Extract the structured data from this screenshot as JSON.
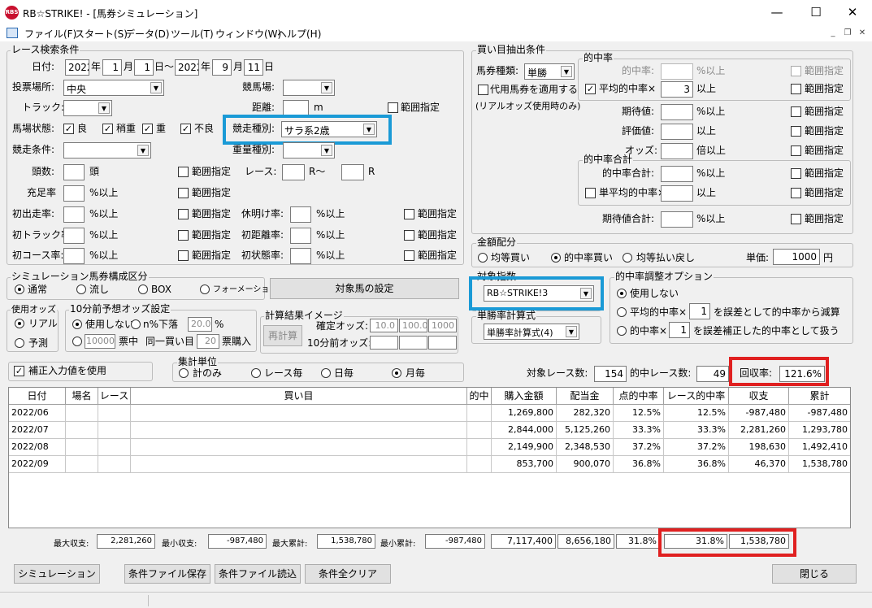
{
  "window": {
    "logo": "RBS",
    "title": "RB☆STRIKE! - [馬券シミュレーション]",
    "minimize": "—",
    "maximize": "☐",
    "close": "✕"
  },
  "menu": [
    "ファイル(F)",
    "スタート(S)",
    "データ(D)",
    "ツール(T)",
    "ウィンドウ(W)",
    "ヘルプ(H)"
  ],
  "mdi": {
    "min": "_",
    "restore": "❐",
    "close": "✕"
  },
  "race": {
    "group": "レース検索条件",
    "date_label": "日付:",
    "y1": "2022",
    "m1": "1",
    "d1": "1",
    "y2": "2022",
    "m2": "9",
    "d2": "11",
    "u_year": "年",
    "u_month": "月",
    "u_day_from": "日〜",
    "u_year2": "年",
    "u_month2": "月",
    "u_day2": "日",
    "venue_label": "投票場所:",
    "venue": "中央",
    "course_label": "競馬場:",
    "track_label": "トラック:",
    "distance_label": "距離:",
    "distance_unit": "m",
    "range": "範囲指定",
    "condition_label": "馬場状態:",
    "c1": "良",
    "c2": "稍重",
    "c3": "重",
    "c4": "不良",
    "race_type_label": "競走種別:",
    "race_type": "サラ系2歳",
    "cond_label": "競走条件:",
    "weight_label": "重量種別:",
    "heads_label": "頭数:",
    "heads_unit": "頭",
    "race_no_label": "レース:",
    "race_from": "R〜",
    "race_to": "R",
    "fill_label": "充足率",
    "pct_above": "%以上",
    "first_run": "初出走率:",
    "first_track": "初トラック率:",
    "first_course": "初コース率:",
    "rest": "休明け率:",
    "first_dist": "初距離率:",
    "first_state": "初状態率:"
  },
  "sim": {
    "group": "シミュレーション馬券構成区分",
    "o1": "通常",
    "o2": "流し",
    "o3": "BOX",
    "o4": "フォーメーション",
    "target_btn": "対象馬の設定"
  },
  "odds": {
    "group": "使用オッズ",
    "o1": "リアル",
    "o2": "予測"
  },
  "odds10": {
    "group": "10分前予想オッズ設定",
    "o1": "使用しない",
    "o2": "n%下落",
    "pct": "20.0",
    "pct_unit": "%",
    "votes": "10000",
    "votes_label": "票中",
    "same": "同一買い目",
    "buy": "20",
    "buy_label": "票購入"
  },
  "calc": {
    "group": "計算結果イメージ",
    "btn": "再計算",
    "fixed": "確定オッズ:",
    "v1": "10.0",
    "v2": "100.0",
    "v3": "1000",
    "pre": "10分前オッズ:"
  },
  "correct": "補正入力値を使用",
  "agg": {
    "group": "集計単位",
    "o1": "計のみ",
    "o2": "レース毎",
    "o3": "日毎",
    "o4": "月毎"
  },
  "buy": {
    "group": "買い目抽出条件",
    "type_label": "馬券種類:",
    "type": "単勝",
    "proxy": "代用馬券を適用する",
    "proxy_note": "(リアルオッズ使用時のみ)"
  },
  "hit": {
    "group": "的中率",
    "rate": "的中率:",
    "pct_above": "%以上",
    "avg": "平均的中率×",
    "avg_val": "3",
    "above": "以上",
    "range": "範囲指定",
    "exp": "期待値:",
    "eval": "評価値:",
    "odds": "オッズ:",
    "times_above": "倍以上"
  },
  "hitsum": {
    "group": "的中率合計",
    "sum": "的中率合計:",
    "pct_above": "%以上",
    "single": "単平均的中率×",
    "above": "以上",
    "exp_sum": "期待値合計:"
  },
  "money": {
    "group": "金額配分",
    "o1": "均等買い",
    "o2": "的中率買い",
    "o3": "均等払い戻し",
    "unit_label": "単価:",
    "unit": "1000",
    "yen": "円"
  },
  "index": {
    "group": "対象指数",
    "value": "RB☆STRIKE!3"
  },
  "formula": {
    "group": "単勝率計算式",
    "value": "単勝率計算式(4)"
  },
  "adjust": {
    "group": "的中率調整オプション",
    "o1": "使用しない",
    "o2": "平均的中率×",
    "o2_tail": "を誤差として的中率から減算",
    "o3": "的中率×",
    "o3_tail": "を誤差補正した的中率として扱う",
    "v2": "1",
    "v3": "1"
  },
  "summary": {
    "races_label": "対象レース数:",
    "races": "154",
    "hits_label": "的中レース数:",
    "hits": "49",
    "return_label": "回収率:",
    "return": "121.6%"
  },
  "table": {
    "headers": [
      "日付",
      "場名",
      "レース",
      "買い目",
      "的中",
      "購入金額",
      "配当金",
      "点的中率",
      "レース的中率",
      "収支",
      "累計"
    ],
    "rows": [
      [
        "2022/06",
        "",
        "",
        "",
        "",
        "1,269,800",
        "282,320",
        "12.5%",
        "12.5%",
        "-987,480",
        "-987,480"
      ],
      [
        "2022/07",
        "",
        "",
        "",
        "",
        "2,844,000",
        "5,125,260",
        "33.3%",
        "33.3%",
        "2,281,260",
        "1,293,780"
      ],
      [
        "2022/08",
        "",
        "",
        "",
        "",
        "2,149,900",
        "2,348,530",
        "37.2%",
        "37.2%",
        "198,630",
        "1,492,410"
      ],
      [
        "2022/09",
        "",
        "",
        "",
        "",
        "853,700",
        "900,070",
        "36.8%",
        "36.8%",
        "46,370",
        "1,538,780"
      ]
    ]
  },
  "footer": {
    "max_label": "最大収支:",
    "max": "2,281,260",
    "min_label": "最小収支:",
    "min": "-987,480",
    "maxc_label": "最大累計:",
    "maxc": "1,538,780",
    "minc_label": "最小累計:",
    "minc": "-987,480",
    "buy": "7,117,400",
    "pay": "8,656,180",
    "hit": "31.8%",
    "race_hit": "31.8%",
    "cum": "1,538,780"
  },
  "buttons": {
    "sim": "シミュレーション",
    "save": "条件ファイル保存",
    "load": "条件ファイル読込",
    "clear": "条件全クリア",
    "close": "閉じる"
  },
  "colors": {
    "highlight_blue": "#1a9ad6",
    "highlight_red": "#e02020"
  }
}
